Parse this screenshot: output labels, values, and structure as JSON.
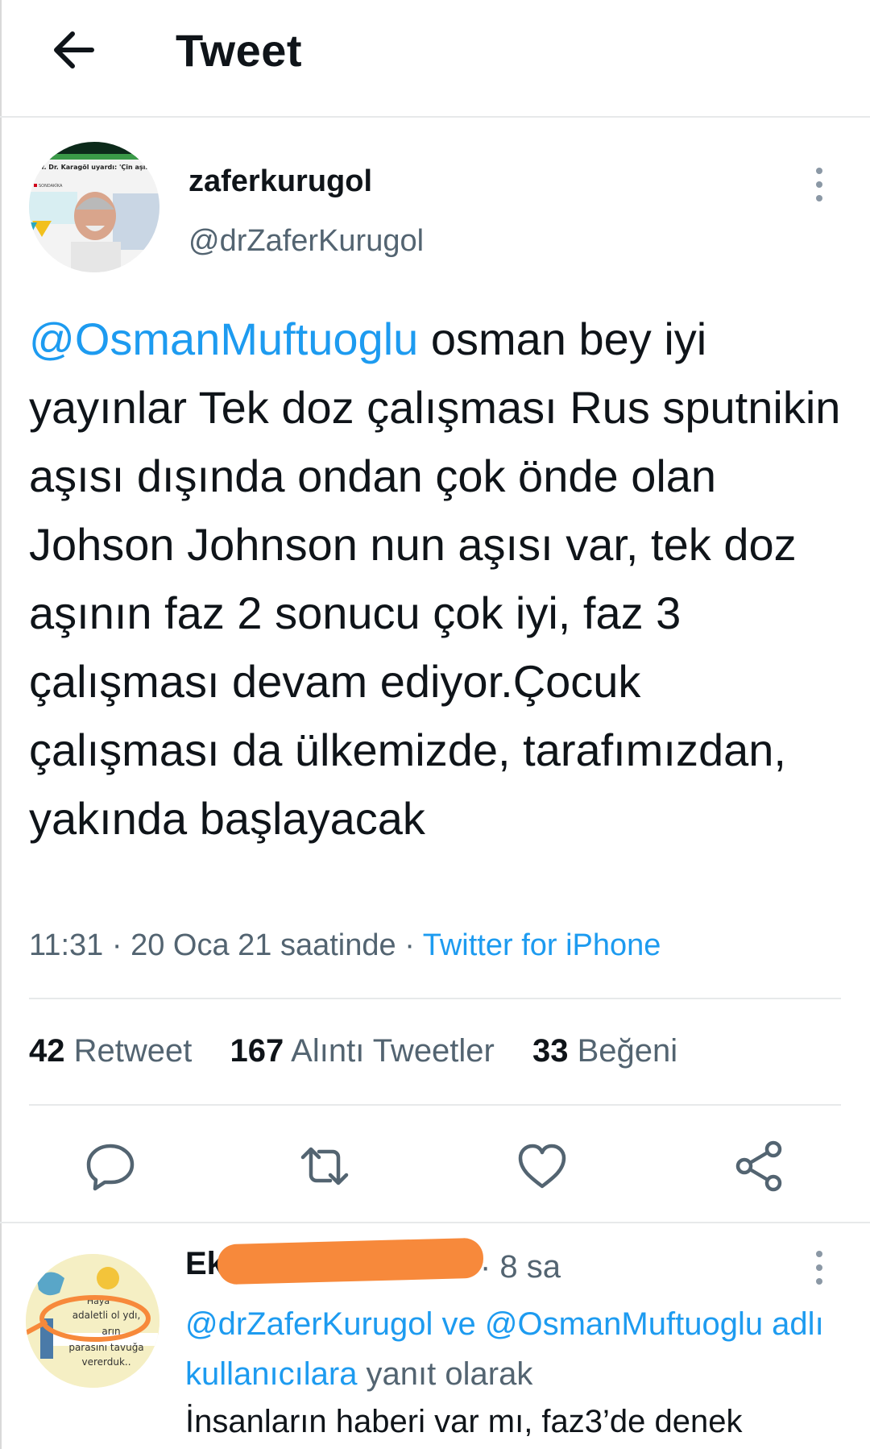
{
  "header": {
    "title": "Tweet",
    "back_icon": "arrow-left-icon"
  },
  "tweet": {
    "author_name": "zaferkurugol",
    "author_handle": "@drZaferKurugol",
    "avatar_caption": "rof. Dr. Karagöl uyardı: 'Çin aşısı deyip geçmeyin, mutlaka aşı yaptırın'",
    "avatar_tag": "SONDAKİKA",
    "mention": "@OsmanMuftuoglu",
    "text": " osman bey iyi yayınlar Tek doz çalışması Rus sputnikin aşısı dışında ondan çok önde olan Johson Johnson nun aşısı var, tek doz aşının faz 2 sonucu çok iyi, faz 3 çalışması devam ediyor.Çocuk çalışması da ülkemizde, tarafımızdan, yakında başlayacak",
    "time": "11:31",
    "date": "20 Oca 21 saatinde",
    "source": "Twitter for iPhone",
    "sep": "·"
  },
  "stats": {
    "retweets_count": "42",
    "retweets_label": "Retweet",
    "quotes_count": "167",
    "quotes_label": "Alıntı Tweetler",
    "likes_count": "33",
    "likes_label": "Beğeni"
  },
  "actions": [
    "reply-icon",
    "retweet-icon",
    "like-icon",
    "share-icon"
  ],
  "reply": {
    "name_visible": "Ek",
    "time": "· 8 sa",
    "replying_links": "@drZaferKurugol ve @OsmanMuftuoglu adlı kullanıcılara",
    "replying_suffix": " yanıt olarak",
    "text": "İnsanların haberi var mı, faz3’de denek",
    "avatar_caption_lines": [
      "Haya",
      "adaletli ol   ydı,",
      "   arın",
      "parasını tavuğa",
      "vererduk.."
    ]
  },
  "colors": {
    "accent": "#1d9bf0",
    "secondary": "#536471",
    "text": "#0f1419",
    "redaction": "#f7893b"
  }
}
